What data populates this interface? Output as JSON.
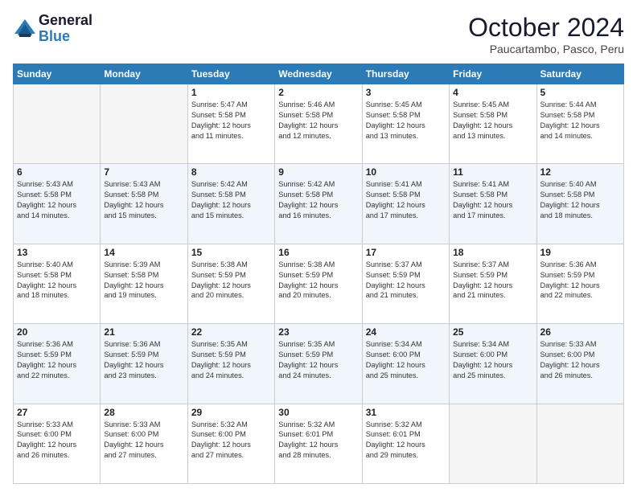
{
  "logo": {
    "line1": "General",
    "line2": "Blue"
  },
  "header": {
    "month": "October 2024",
    "location": "Paucartambo, Pasco, Peru"
  },
  "weekdays": [
    "Sunday",
    "Monday",
    "Tuesday",
    "Wednesday",
    "Thursday",
    "Friday",
    "Saturday"
  ],
  "weeks": [
    [
      {
        "day": "",
        "text": ""
      },
      {
        "day": "",
        "text": ""
      },
      {
        "day": "1",
        "text": "Sunrise: 5:47 AM\nSunset: 5:58 PM\nDaylight: 12 hours\nand 11 minutes."
      },
      {
        "day": "2",
        "text": "Sunrise: 5:46 AM\nSunset: 5:58 PM\nDaylight: 12 hours\nand 12 minutes."
      },
      {
        "day": "3",
        "text": "Sunrise: 5:45 AM\nSunset: 5:58 PM\nDaylight: 12 hours\nand 13 minutes."
      },
      {
        "day": "4",
        "text": "Sunrise: 5:45 AM\nSunset: 5:58 PM\nDaylight: 12 hours\nand 13 minutes."
      },
      {
        "day": "5",
        "text": "Sunrise: 5:44 AM\nSunset: 5:58 PM\nDaylight: 12 hours\nand 14 minutes."
      }
    ],
    [
      {
        "day": "6",
        "text": "Sunrise: 5:43 AM\nSunset: 5:58 PM\nDaylight: 12 hours\nand 14 minutes."
      },
      {
        "day": "7",
        "text": "Sunrise: 5:43 AM\nSunset: 5:58 PM\nDaylight: 12 hours\nand 15 minutes."
      },
      {
        "day": "8",
        "text": "Sunrise: 5:42 AM\nSunset: 5:58 PM\nDaylight: 12 hours\nand 15 minutes."
      },
      {
        "day": "9",
        "text": "Sunrise: 5:42 AM\nSunset: 5:58 PM\nDaylight: 12 hours\nand 16 minutes."
      },
      {
        "day": "10",
        "text": "Sunrise: 5:41 AM\nSunset: 5:58 PM\nDaylight: 12 hours\nand 17 minutes."
      },
      {
        "day": "11",
        "text": "Sunrise: 5:41 AM\nSunset: 5:58 PM\nDaylight: 12 hours\nand 17 minutes."
      },
      {
        "day": "12",
        "text": "Sunrise: 5:40 AM\nSunset: 5:58 PM\nDaylight: 12 hours\nand 18 minutes."
      }
    ],
    [
      {
        "day": "13",
        "text": "Sunrise: 5:40 AM\nSunset: 5:58 PM\nDaylight: 12 hours\nand 18 minutes."
      },
      {
        "day": "14",
        "text": "Sunrise: 5:39 AM\nSunset: 5:58 PM\nDaylight: 12 hours\nand 19 minutes."
      },
      {
        "day": "15",
        "text": "Sunrise: 5:38 AM\nSunset: 5:59 PM\nDaylight: 12 hours\nand 20 minutes."
      },
      {
        "day": "16",
        "text": "Sunrise: 5:38 AM\nSunset: 5:59 PM\nDaylight: 12 hours\nand 20 minutes."
      },
      {
        "day": "17",
        "text": "Sunrise: 5:37 AM\nSunset: 5:59 PM\nDaylight: 12 hours\nand 21 minutes."
      },
      {
        "day": "18",
        "text": "Sunrise: 5:37 AM\nSunset: 5:59 PM\nDaylight: 12 hours\nand 21 minutes."
      },
      {
        "day": "19",
        "text": "Sunrise: 5:36 AM\nSunset: 5:59 PM\nDaylight: 12 hours\nand 22 minutes."
      }
    ],
    [
      {
        "day": "20",
        "text": "Sunrise: 5:36 AM\nSunset: 5:59 PM\nDaylight: 12 hours\nand 22 minutes."
      },
      {
        "day": "21",
        "text": "Sunrise: 5:36 AM\nSunset: 5:59 PM\nDaylight: 12 hours\nand 23 minutes."
      },
      {
        "day": "22",
        "text": "Sunrise: 5:35 AM\nSunset: 5:59 PM\nDaylight: 12 hours\nand 24 minutes."
      },
      {
        "day": "23",
        "text": "Sunrise: 5:35 AM\nSunset: 5:59 PM\nDaylight: 12 hours\nand 24 minutes."
      },
      {
        "day": "24",
        "text": "Sunrise: 5:34 AM\nSunset: 6:00 PM\nDaylight: 12 hours\nand 25 minutes."
      },
      {
        "day": "25",
        "text": "Sunrise: 5:34 AM\nSunset: 6:00 PM\nDaylight: 12 hours\nand 25 minutes."
      },
      {
        "day": "26",
        "text": "Sunrise: 5:33 AM\nSunset: 6:00 PM\nDaylight: 12 hours\nand 26 minutes."
      }
    ],
    [
      {
        "day": "27",
        "text": "Sunrise: 5:33 AM\nSunset: 6:00 PM\nDaylight: 12 hours\nand 26 minutes."
      },
      {
        "day": "28",
        "text": "Sunrise: 5:33 AM\nSunset: 6:00 PM\nDaylight: 12 hours\nand 27 minutes."
      },
      {
        "day": "29",
        "text": "Sunrise: 5:32 AM\nSunset: 6:00 PM\nDaylight: 12 hours\nand 27 minutes."
      },
      {
        "day": "30",
        "text": "Sunrise: 5:32 AM\nSunset: 6:01 PM\nDaylight: 12 hours\nand 28 minutes."
      },
      {
        "day": "31",
        "text": "Sunrise: 5:32 AM\nSunset: 6:01 PM\nDaylight: 12 hours\nand 29 minutes."
      },
      {
        "day": "",
        "text": ""
      },
      {
        "day": "",
        "text": ""
      }
    ]
  ]
}
